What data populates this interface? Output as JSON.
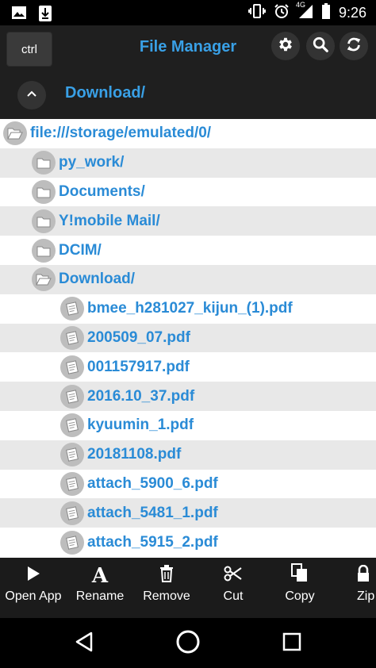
{
  "status_bar": {
    "time": "9:26",
    "network_label": "4G",
    "left_icons": [
      "image-icon",
      "download-icon"
    ],
    "right_icons": [
      "vibrate-icon",
      "alarm-icon",
      "signal-icon",
      "battery-icon"
    ]
  },
  "header": {
    "ctrl_label": "ctrl",
    "title": "File Manager",
    "actions": [
      "settings-icon",
      "search-icon",
      "refresh-icon"
    ]
  },
  "current_path": "Download/",
  "tree": [
    {
      "label": "file:///storage/emulated/0/",
      "icon": "folder-open-icon",
      "depth": 0
    },
    {
      "label": "py_work/",
      "icon": "folder-icon",
      "depth": 1
    },
    {
      "label": "Documents/",
      "icon": "folder-icon",
      "depth": 1
    },
    {
      "label": "Y!mobile Mail/",
      "icon": "folder-icon",
      "depth": 1
    },
    {
      "label": "DCIM/",
      "icon": "folder-icon",
      "depth": 1
    },
    {
      "label": "Download/",
      "icon": "folder-open-icon",
      "depth": 1
    },
    {
      "label": "bmee_h281027_kijun_(1).pdf",
      "icon": "document-icon",
      "depth": 2
    },
    {
      "label": "200509_07.pdf",
      "icon": "document-icon",
      "depth": 2
    },
    {
      "label": "001157917.pdf",
      "icon": "document-icon",
      "depth": 2
    },
    {
      "label": "2016.10_37.pdf",
      "icon": "document-icon",
      "depth": 2
    },
    {
      "label": "kyuumin_1.pdf",
      "icon": "document-icon",
      "depth": 2
    },
    {
      "label": "20181108.pdf",
      "icon": "document-icon",
      "depth": 2
    },
    {
      "label": "attach_5900_6.pdf",
      "icon": "document-icon",
      "depth": 2
    },
    {
      "label": "attach_5481_1.pdf",
      "icon": "document-icon",
      "depth": 2
    },
    {
      "label": "attach_5915_2.pdf",
      "icon": "document-icon",
      "depth": 2
    }
  ],
  "toolbar": {
    "open_app": "Open App",
    "rename": "Rename",
    "remove": "Remove",
    "cut": "Cut",
    "copy": "Copy",
    "zip": "Zip"
  },
  "colors": {
    "accent": "#39a0e6",
    "list_text": "#2a8bd6",
    "header_bg": "#1f1f1f",
    "toolbar_bg": "#1b1b1b"
  }
}
